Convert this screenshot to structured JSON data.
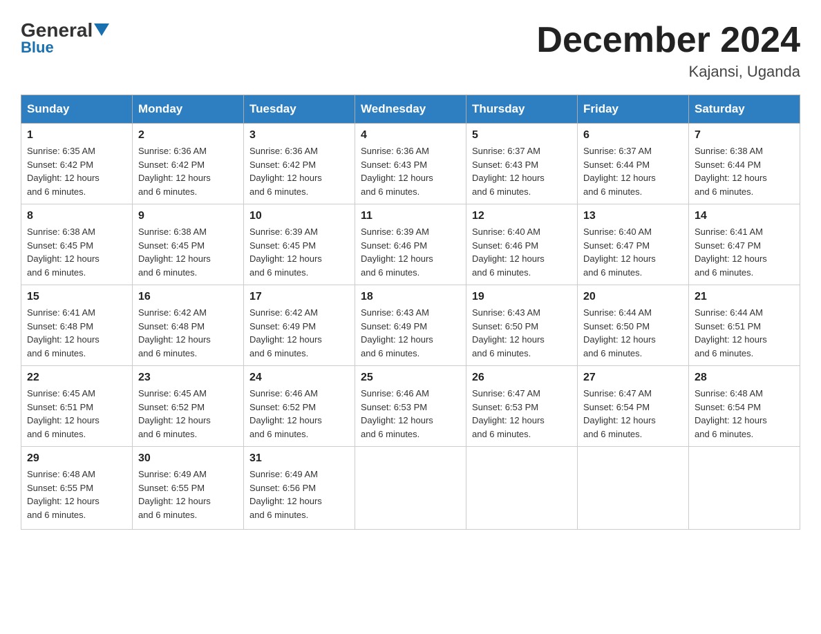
{
  "header": {
    "logo_general": "General",
    "logo_blue": "Blue",
    "month_year": "December 2024",
    "location": "Kajansi, Uganda"
  },
  "days_of_week": [
    "Sunday",
    "Monday",
    "Tuesday",
    "Wednesday",
    "Thursday",
    "Friday",
    "Saturday"
  ],
  "weeks": [
    [
      {
        "day": "1",
        "sunrise": "6:35 AM",
        "sunset": "6:42 PM",
        "daylight": "12 hours and 6 minutes."
      },
      {
        "day": "2",
        "sunrise": "6:36 AM",
        "sunset": "6:42 PM",
        "daylight": "12 hours and 6 minutes."
      },
      {
        "day": "3",
        "sunrise": "6:36 AM",
        "sunset": "6:42 PM",
        "daylight": "12 hours and 6 minutes."
      },
      {
        "day": "4",
        "sunrise": "6:36 AM",
        "sunset": "6:43 PM",
        "daylight": "12 hours and 6 minutes."
      },
      {
        "day": "5",
        "sunrise": "6:37 AM",
        "sunset": "6:43 PM",
        "daylight": "12 hours and 6 minutes."
      },
      {
        "day": "6",
        "sunrise": "6:37 AM",
        "sunset": "6:44 PM",
        "daylight": "12 hours and 6 minutes."
      },
      {
        "day": "7",
        "sunrise": "6:38 AM",
        "sunset": "6:44 PM",
        "daylight": "12 hours and 6 minutes."
      }
    ],
    [
      {
        "day": "8",
        "sunrise": "6:38 AM",
        "sunset": "6:45 PM",
        "daylight": "12 hours and 6 minutes."
      },
      {
        "day": "9",
        "sunrise": "6:38 AM",
        "sunset": "6:45 PM",
        "daylight": "12 hours and 6 minutes."
      },
      {
        "day": "10",
        "sunrise": "6:39 AM",
        "sunset": "6:45 PM",
        "daylight": "12 hours and 6 minutes."
      },
      {
        "day": "11",
        "sunrise": "6:39 AM",
        "sunset": "6:46 PM",
        "daylight": "12 hours and 6 minutes."
      },
      {
        "day": "12",
        "sunrise": "6:40 AM",
        "sunset": "6:46 PM",
        "daylight": "12 hours and 6 minutes."
      },
      {
        "day": "13",
        "sunrise": "6:40 AM",
        "sunset": "6:47 PM",
        "daylight": "12 hours and 6 minutes."
      },
      {
        "day": "14",
        "sunrise": "6:41 AM",
        "sunset": "6:47 PM",
        "daylight": "12 hours and 6 minutes."
      }
    ],
    [
      {
        "day": "15",
        "sunrise": "6:41 AM",
        "sunset": "6:48 PM",
        "daylight": "12 hours and 6 minutes."
      },
      {
        "day": "16",
        "sunrise": "6:42 AM",
        "sunset": "6:48 PM",
        "daylight": "12 hours and 6 minutes."
      },
      {
        "day": "17",
        "sunrise": "6:42 AM",
        "sunset": "6:49 PM",
        "daylight": "12 hours and 6 minutes."
      },
      {
        "day": "18",
        "sunrise": "6:43 AM",
        "sunset": "6:49 PM",
        "daylight": "12 hours and 6 minutes."
      },
      {
        "day": "19",
        "sunrise": "6:43 AM",
        "sunset": "6:50 PM",
        "daylight": "12 hours and 6 minutes."
      },
      {
        "day": "20",
        "sunrise": "6:44 AM",
        "sunset": "6:50 PM",
        "daylight": "12 hours and 6 minutes."
      },
      {
        "day": "21",
        "sunrise": "6:44 AM",
        "sunset": "6:51 PM",
        "daylight": "12 hours and 6 minutes."
      }
    ],
    [
      {
        "day": "22",
        "sunrise": "6:45 AM",
        "sunset": "6:51 PM",
        "daylight": "12 hours and 6 minutes."
      },
      {
        "day": "23",
        "sunrise": "6:45 AM",
        "sunset": "6:52 PM",
        "daylight": "12 hours and 6 minutes."
      },
      {
        "day": "24",
        "sunrise": "6:46 AM",
        "sunset": "6:52 PM",
        "daylight": "12 hours and 6 minutes."
      },
      {
        "day": "25",
        "sunrise": "6:46 AM",
        "sunset": "6:53 PM",
        "daylight": "12 hours and 6 minutes."
      },
      {
        "day": "26",
        "sunrise": "6:47 AM",
        "sunset": "6:53 PM",
        "daylight": "12 hours and 6 minutes."
      },
      {
        "day": "27",
        "sunrise": "6:47 AM",
        "sunset": "6:54 PM",
        "daylight": "12 hours and 6 minutes."
      },
      {
        "day": "28",
        "sunrise": "6:48 AM",
        "sunset": "6:54 PM",
        "daylight": "12 hours and 6 minutes."
      }
    ],
    [
      {
        "day": "29",
        "sunrise": "6:48 AM",
        "sunset": "6:55 PM",
        "daylight": "12 hours and 6 minutes."
      },
      {
        "day": "30",
        "sunrise": "6:49 AM",
        "sunset": "6:55 PM",
        "daylight": "12 hours and 6 minutes."
      },
      {
        "day": "31",
        "sunrise": "6:49 AM",
        "sunset": "6:56 PM",
        "daylight": "12 hours and 6 minutes."
      },
      null,
      null,
      null,
      null
    ]
  ],
  "labels": {
    "sunrise": "Sunrise:",
    "sunset": "Sunset:",
    "daylight": "Daylight:"
  }
}
